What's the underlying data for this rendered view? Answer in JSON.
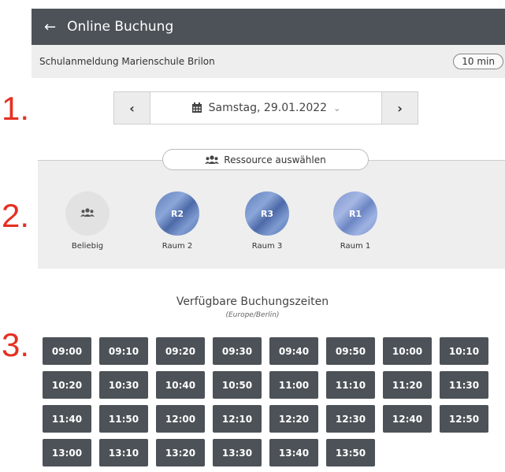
{
  "steps": [
    "1.",
    "2.",
    "3."
  ],
  "header": {
    "back_icon": "arrow-left-icon",
    "title": "Online Buchung"
  },
  "subheader": {
    "school": "Schulanmeldung Marienschule Brilon",
    "duration": "10 min"
  },
  "datepicker": {
    "prev_icon": "chevron-left-icon",
    "next_icon": "chevron-right-icon",
    "date": "Samstag, 29.01.2022"
  },
  "resource": {
    "button_label": "Ressource auswählen",
    "items": [
      {
        "badge": "",
        "name": "Beliebig"
      },
      {
        "badge": "R2",
        "name": "Raum 2"
      },
      {
        "badge": "R3",
        "name": "Raum 3"
      },
      {
        "badge": "R1",
        "name": "Raum 1"
      }
    ]
  },
  "slots": {
    "title": "Verfügbare Buchungszeiten",
    "timezone": "(Europe/Berlin)",
    "times": [
      "09:00",
      "09:10",
      "09:20",
      "09:30",
      "09:40",
      "09:50",
      "10:00",
      "10:10",
      "10:20",
      "10:30",
      "10:40",
      "10:50",
      "11:00",
      "11:10",
      "11:20",
      "11:30",
      "11:40",
      "11:50",
      "12:00",
      "12:10",
      "12:20",
      "12:30",
      "12:40",
      "12:50",
      "13:00",
      "13:10",
      "13:20",
      "13:30",
      "13:40",
      "13:50"
    ]
  },
  "colors": {
    "header_bg": "#4c5257",
    "slot_bg": "#4c5257",
    "step_label": "#e53022",
    "panel_bg": "#eeeeee"
  }
}
